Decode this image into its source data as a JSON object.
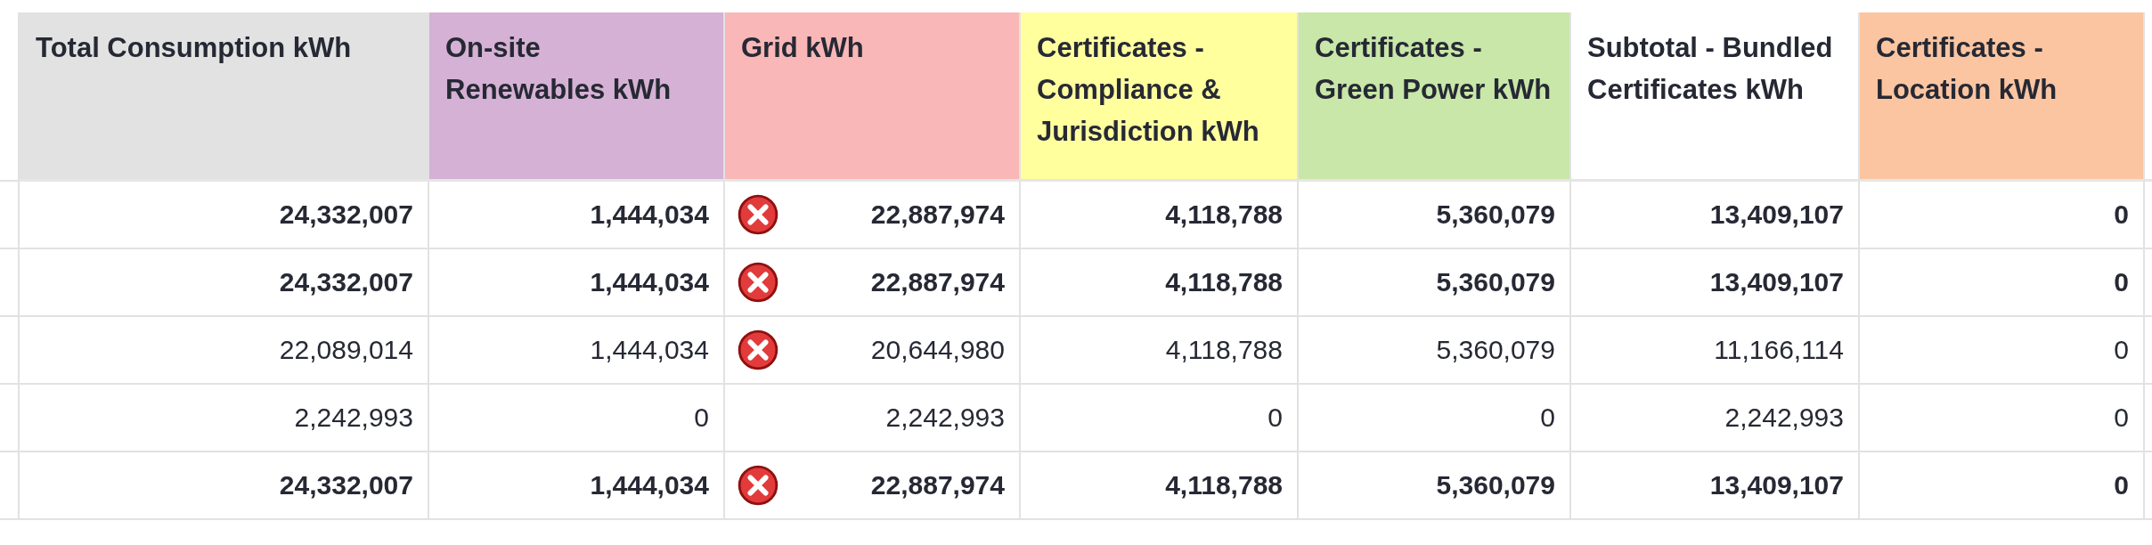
{
  "table": {
    "columns": [
      {
        "label": "Total Consumption kWh",
        "color": "#e2e2e2"
      },
      {
        "label": "On-site Renewables kWh",
        "color": "#d5b1d5"
      },
      {
        "label": "Grid kWh",
        "color": "#f9b7b7"
      },
      {
        "label": "Certificates - Compliance & Jurisdiction kWh",
        "color": "#ffff9e"
      },
      {
        "label": "Certificates - Green Power kWh",
        "color": "#c8e7a8"
      },
      {
        "label": "Subtotal - Bundled Certificates kWh",
        "color": "#ffffff"
      },
      {
        "label": "Certificates - Location kWh",
        "color": "#fbc5a1"
      }
    ],
    "rows": [
      {
        "bold": true,
        "grid_error": true,
        "values": [
          "24,332,007",
          "1,444,034",
          "22,887,974",
          "4,118,788",
          "5,360,079",
          "13,409,107",
          "0"
        ]
      },
      {
        "bold": true,
        "grid_error": true,
        "values": [
          "24,332,007",
          "1,444,034",
          "22,887,974",
          "4,118,788",
          "5,360,079",
          "13,409,107",
          "0"
        ]
      },
      {
        "bold": false,
        "grid_error": true,
        "values": [
          "22,089,014",
          "1,444,034",
          "20,644,980",
          "4,118,788",
          "5,360,079",
          "11,166,114",
          "0"
        ]
      },
      {
        "bold": false,
        "grid_error": false,
        "values": [
          "2,242,993",
          "0",
          "2,242,993",
          "0",
          "0",
          "2,242,993",
          "0"
        ]
      },
      {
        "bold": true,
        "grid_error": true,
        "values": [
          "24,332,007",
          "1,444,034",
          "22,887,974",
          "4,118,788",
          "5,360,079",
          "13,409,107",
          "0"
        ]
      }
    ]
  }
}
